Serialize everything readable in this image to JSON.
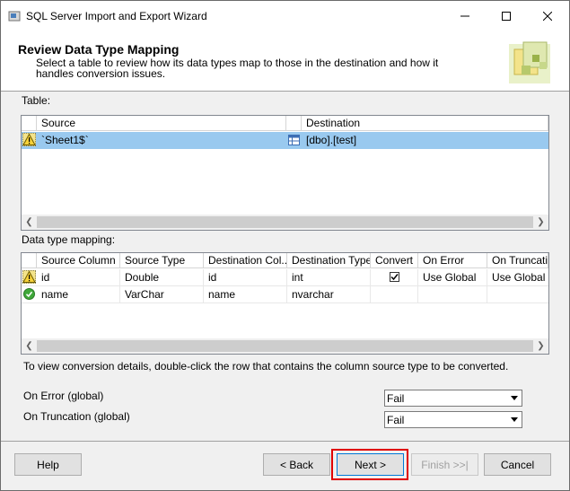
{
  "window": {
    "title": "SQL Server Import and Export Wizard"
  },
  "header": {
    "title": "Review Data Type Mapping",
    "description": "Select a table to review how its data types map to those in the destination and how it handles conversion issues."
  },
  "table_section": {
    "label": "Table:",
    "columns": [
      "Source",
      "Destination"
    ],
    "rows": [
      {
        "status": "warning-icon",
        "source": "`Sheet1$`",
        "destination": "[dbo].[test]"
      }
    ]
  },
  "mapping_section": {
    "label": "Data type mapping:",
    "columns": [
      "Source Column",
      "Source Type",
      "Destination Col...",
      "Destination Type",
      "Convert",
      "On Error",
      "On Truncati..."
    ],
    "rows": [
      {
        "status": "warning-icon",
        "source_column": "id",
        "source_type": "Double",
        "dest_column": "id",
        "dest_type": "int",
        "convert": true,
        "on_error": "Use Global",
        "on_truncation": "Use Global"
      },
      {
        "status": "check-icon",
        "source_column": "name",
        "source_type": "VarChar",
        "dest_column": "name",
        "dest_type": "nvarchar",
        "convert": false,
        "on_error": "",
        "on_truncation": ""
      }
    ]
  },
  "hint": "To view conversion details, double-click the row that contains the column source type to be converted.",
  "global": {
    "on_error_label": "On Error (global)",
    "on_error_value": "Fail",
    "on_truncation_label": "On Truncation (global)",
    "on_truncation_value": "Fail"
  },
  "buttons": {
    "help": "Help",
    "back": "< Back",
    "next": "Next >",
    "finish": "Finish >>|",
    "cancel": "Cancel"
  },
  "colors": {
    "selected_row": "#99c9ef",
    "highlight": "#e00000",
    "focus": "#0078d7"
  }
}
